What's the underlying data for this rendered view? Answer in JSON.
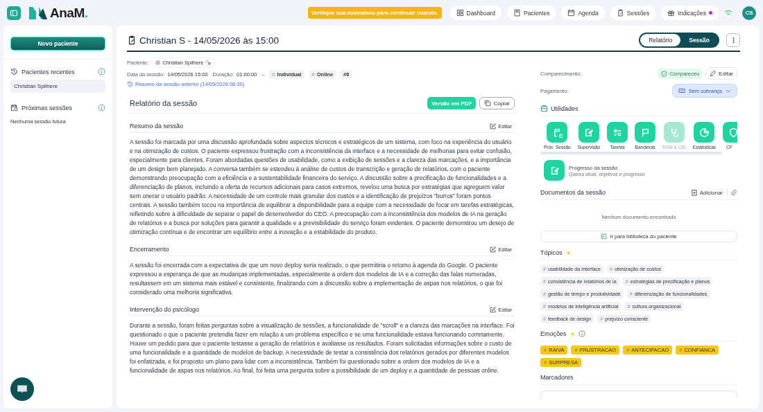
{
  "header": {
    "logo": "AnaM",
    "logo_dot": ".",
    "alert": "Verifique sua assinatura para continuar usando.",
    "nav": [
      {
        "label": "Dashboard",
        "dot": false
      },
      {
        "label": "Pacientes",
        "dot": false
      },
      {
        "label": "Agenda",
        "dot": false
      },
      {
        "label": "Sessões",
        "dot": false
      },
      {
        "label": "Indicações",
        "dot": true
      }
    ],
    "avatar": "CS"
  },
  "sidebar": {
    "new_button": "Novo paciente",
    "recent": {
      "title": "Pacientes recentes",
      "items": [
        {
          "label": "Christian Spilhere",
          "selected": true
        }
      ]
    },
    "upcoming": {
      "title": "Próximas sessões",
      "empty": "Nenhuma sessão futura"
    }
  },
  "session": {
    "title": "Christian S - 14/05/2026 às 15:00",
    "toggle": [
      {
        "label": "Relatório",
        "selected": false
      },
      {
        "label": "Sessão",
        "selected": true
      }
    ],
    "patient_label": "Paciente:",
    "patient": "Christian Spilhere",
    "date_label": "Data da sessão:",
    "date": "14/05/2026 15:00",
    "duration_label": "Duração:",
    "duration": "01:00:00",
    "dash": "–",
    "tags": [
      {
        "hash": "#",
        "label": "Individual"
      },
      {
        "hash": "#",
        "label": "Online"
      },
      {
        "label": "#6"
      }
    ],
    "previous": "Resumo da sessão anterior (14/05/2026 08:30)",
    "report": {
      "title": "Relatório da sessão",
      "pdf": "Versão em PDF",
      "copy": "Copiar",
      "sections": [
        {
          "title": "Resumo da sessão",
          "edit": "Editar",
          "text": "A sessão foi marcada por uma discussão aprofundada sobre aspectos técnicos e estratégicos de um sistema, com foco na experiência do usuário e na otimização de custos. O paciente expressou frustração com a inconsistência da interface e a necessidade de melhorias para evitar confusão, especialmente para clientes. Foram abordadas questões de usabilidade, como a exibição de sessões e a clareza das marcações, e a importância de um design bem planejado. A conversa também se estendeu à análise de custos de transcrição e geração de relatórios, com o paciente demonstrando preocupação com a eficiência e a sustentabilidade financeira do serviço. A discussão sobre a precificação de funcionalidades e a diferenciação de planos, incluindo a oferta de recursos adicionais para casos extremos, revelou uma busca por estratégias que agreguem valor sem onerar o usuário padrão. A necessidade de um controle mais granular dos custos e a identificação de prejuízos “burros” foram pontos centrais. A sessão também tocou na importância de equilibrar a disponibilidade para a equipe com a necessidade de focar em tarefas estratégicas, refletindo sobre a dificuldade de separar o papel de desenvolvedor do CEO. A preocupação com a inconsistência dos modelos de IA na geração de relatórios e a busca por soluções para garantir a qualidade e a previsibilidade do serviço foram evidentes. O paciente demonstrou um desejo de otimização contínua e de encontrar um equilíbrio entre a inovação e a estabilidade do produto."
        },
        {
          "title": "Encerramento",
          "edit": "Editar",
          "text": "A sessão foi encerrada com a expectativa de que um novo deploy seria realizado, o que permitiria o retorno à agenda do Google. O paciente expressou a esperança de que as mudanças implementadas, especialmente a ordem dos modelos de IA e a correção das falas numeradas, resultassem em um sistema mais estável e consistente, finalizando com a discussão sobre a implementação de aspas nos relatórios, o que foi considerado uma melhoria significativa."
        },
        {
          "title": "Intervenção do psicólogo",
          "edit": "Editar",
          "text": "Durante a sessão, foram feitas perguntas sobre a visualização de sessões, a funcionalidade de \"scroll\" e a clareza das marcações na interface. Foi questionado o que o paciente pretendia fazer em relação a um problema específico e se uma funcionalidade estava funcionando corretamente. Houve um pedido para que o paciente testasse a geração de relatórios e avaliasse os resultados. Foram solicitadas informações sobre o custo de uma funcionalidade e a quantidade de modelos de backup. A necessidade de testar a consistência dos relatórios gerados por diferentes modelos foi enfatizada, e foi proposto um plano para lidar com a inconsistência. Também foi questionado sobre a ordem dos modelos de IA e a funcionalidade de aspas nos relatórios. Ao final, foi feita uma pergunta sobre a possibilidade de um deploy e a quantidade de pessoas online."
        }
      ]
    }
  },
  "details": {
    "attendance_label": "Comparecimento:",
    "attendance": "Compareceu",
    "edit": "Editar",
    "payment_label": "Pagamento:",
    "payment": "Sem cobrança",
    "utilities": {
      "title": "Utilidades",
      "items": [
        {
          "label": "Próx. Sessão",
          "disabled": false
        },
        {
          "label": "Supervisão",
          "disabled": false
        },
        {
          "label": "Tarefas",
          "disabled": false
        },
        {
          "label": "Bandeiras",
          "disabled": false
        },
        {
          "label": "DSM & CID",
          "disabled": true
        },
        {
          "label": "Estatísticas",
          "disabled": false
        },
        {
          "label": "CF",
          "disabled": false
        }
      ],
      "progress_title": "Progresso da sessão",
      "progress_sub": "Queixa atual, objetivos e progresso"
    },
    "documents": {
      "title": "Documentos da sessão",
      "add": "Adicionar",
      "empty": "Nenhum documento encontrado",
      "library": "Ir para biblioteca do paciente"
    },
    "topics": {
      "title": "Tópicos",
      "items": [
        {
          "hash": "#",
          "label": "usabilidade da interface"
        },
        {
          "hash": "#",
          "label": "otimização de custos"
        },
        {
          "hash": "#",
          "label": "consistência de relatórios de ia"
        },
        {
          "hash": "#",
          "label": "estratégias de precificação e planos"
        },
        {
          "hash": "#",
          "label": "gestão de tempo e produtividade"
        },
        {
          "hash": "#",
          "label": "diferenciação de funcionalidades"
        },
        {
          "hash": "#",
          "label": "modelos de inteligência artificial"
        },
        {
          "hash": "#",
          "label": "cultura organizacional"
        },
        {
          "hash": "#",
          "label": "feedback de design"
        },
        {
          "hash": "#",
          "label": "prejuízo consciente"
        }
      ]
    },
    "emotions": {
      "title": "Emoções",
      "items": [
        {
          "hash": "#",
          "label": "RAIVA"
        },
        {
          "hash": "#",
          "label": "FRUSTRACAO"
        },
        {
          "hash": "#",
          "label": "ANTECIPACAO"
        },
        {
          "hash": "#",
          "label": "CONFIANCA"
        },
        {
          "hash": "#",
          "label": "SURPRESA"
        }
      ]
    },
    "markers": {
      "title": "Marcadores"
    }
  }
}
